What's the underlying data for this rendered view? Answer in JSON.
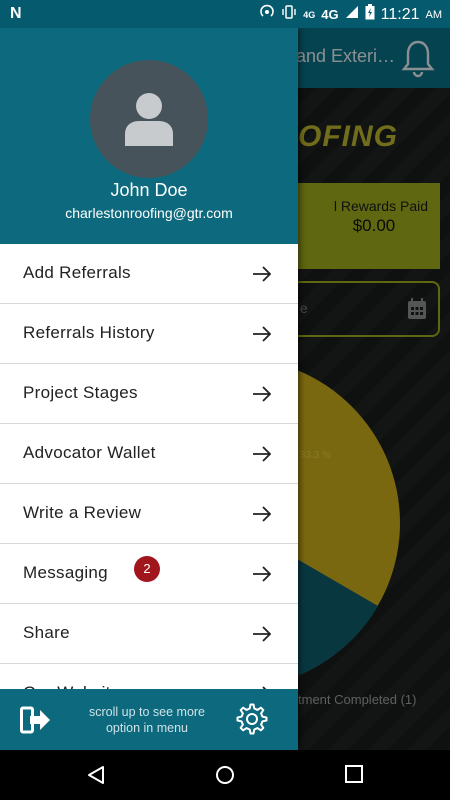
{
  "status_bar": {
    "left_icon": "n-notification-icon",
    "network": "4G",
    "network_small": "4G",
    "time": "11:21",
    "ampm": "AM"
  },
  "background_screen": {
    "title_fragment": "and Exteri…",
    "logo_fragment": "OFING",
    "card_label_fragment": "l Rewards Paid",
    "card_value": "$0.00",
    "date_field_fragment": "e",
    "pie_percent_label": "33.3 %",
    "legend_fragment": "tment Completed (1)",
    "colors": {
      "header": "#0b6d82",
      "card": "#9aa71a",
      "pie_yellow": "#c5a91c",
      "pie_teal": "#0f5a68"
    }
  },
  "drawer": {
    "user": {
      "name": "John Doe",
      "email": "charlestonroofing@gtr.com"
    },
    "menu": [
      {
        "label": "Add Referrals"
      },
      {
        "label": "Referrals History"
      },
      {
        "label": "Project Stages"
      },
      {
        "label": "Advocator Wallet"
      },
      {
        "label": "Write a Review"
      },
      {
        "label": "Messaging",
        "badge": "2"
      },
      {
        "label": "Share"
      },
      {
        "label": "Our Website"
      }
    ],
    "footer": {
      "scroll_hint": "scroll up to see more option in menu",
      "logout_icon": "logout-icon",
      "settings_icon": "gear-icon"
    },
    "colors": {
      "header": "#0d6a7e",
      "badge": "#a0161c"
    }
  },
  "nav_bar": {
    "back": "back-icon",
    "home": "home-icon",
    "recents": "recents-icon"
  }
}
